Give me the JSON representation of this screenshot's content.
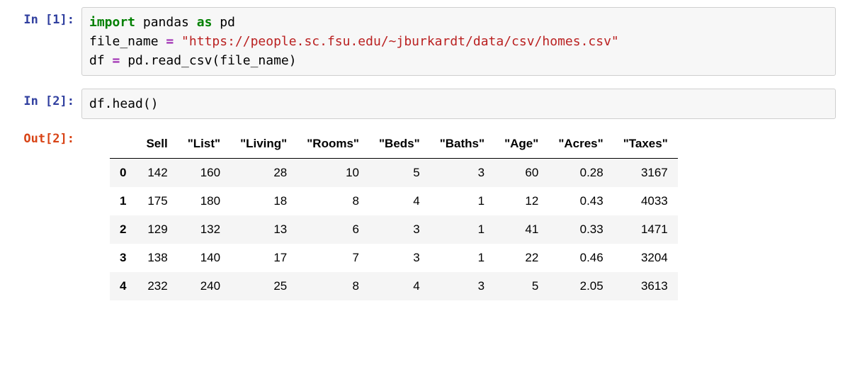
{
  "cells": {
    "in1": {
      "prompt": "In [1]:",
      "kw_import": "import",
      "mod_pandas": " pandas ",
      "kw_as": "as",
      "alias": " pd",
      "line2_pre": "file_name ",
      "op_eq1": "=",
      "line2_str": " \"https://people.sc.fsu.edu/~jburkardt/data/csv/homes.csv\"",
      "line3_pre": "df ",
      "op_eq2": "=",
      "line3_post": " pd.read_csv(file_name)"
    },
    "in2": {
      "prompt": "In [2]:",
      "code": "df.head()"
    },
    "out2": {
      "prompt": "Out[2]:"
    }
  },
  "chart_data": {
    "type": "table",
    "columns": [
      "Sell",
      "\"List\"",
      "\"Living\"",
      "\"Rooms\"",
      "\"Beds\"",
      "\"Baths\"",
      "\"Age\"",
      "\"Acres\"",
      "\"Taxes\""
    ],
    "index": [
      "0",
      "1",
      "2",
      "3",
      "4"
    ],
    "rows": [
      [
        "142",
        "160",
        "28",
        "10",
        "5",
        "3",
        "60",
        "0.28",
        "3167"
      ],
      [
        "175",
        "180",
        "18",
        "8",
        "4",
        "1",
        "12",
        "0.43",
        "4033"
      ],
      [
        "129",
        "132",
        "13",
        "6",
        "3",
        "1",
        "41",
        "0.33",
        "1471"
      ],
      [
        "138",
        "140",
        "17",
        "7",
        "3",
        "1",
        "22",
        "0.46",
        "3204"
      ],
      [
        "232",
        "240",
        "25",
        "8",
        "4",
        "3",
        "5",
        "2.05",
        "3613"
      ]
    ]
  }
}
